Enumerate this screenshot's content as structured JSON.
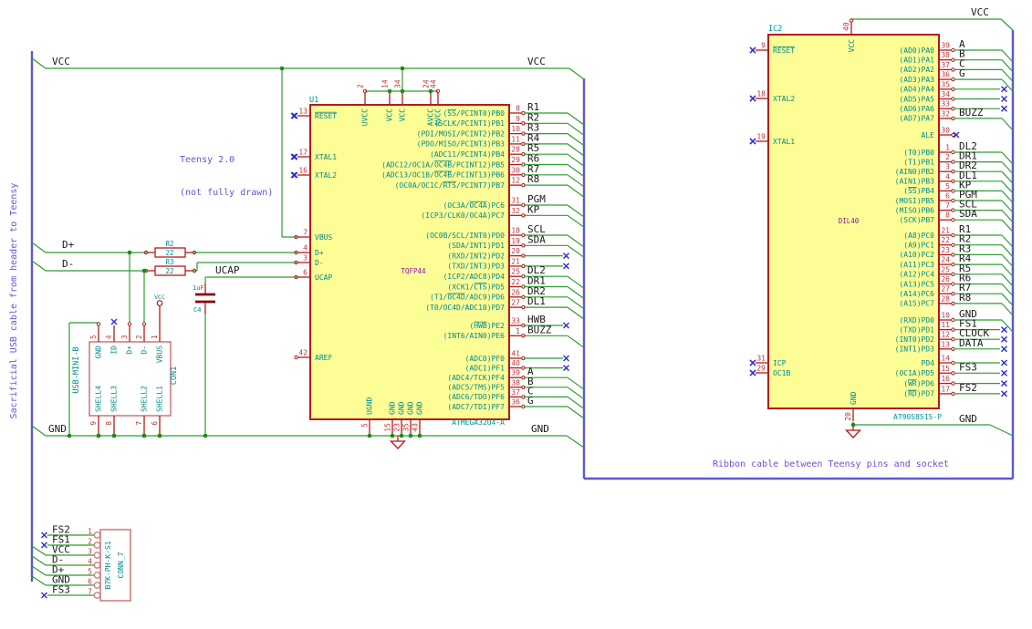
{
  "colors": {
    "wire": "#2f9e2f",
    "junction": "#1d8a1d",
    "bus": "#5b57d4",
    "device": "#b51a1a",
    "device_fill": "#fdfd96",
    "connector": "#d07f7f",
    "pin_number": "#c03535",
    "pin_name": "#008b8b",
    "reference": "#009595",
    "value": "#8a1a9e",
    "net_label": "#1a1a1a",
    "no_connect": "#2a2ad4",
    "note": "#6a52d8",
    "cap_plate": "#8b0000"
  },
  "notes": {
    "left_bus": "Sacrificial USB cable from header to Teensy",
    "teensy_line1": "Teensy 2.0",
    "teensy_line2": "(not fully drawn)",
    "ribbon": "Ribbon cable between Teensy pins and socket"
  },
  "power_labels": {
    "vcc_left": "VCC",
    "vcc_mid": "VCC",
    "vcc_right": "VCC",
    "gnd_left": "GND",
    "gnd_mid": "GND",
    "gnd_right": "GND",
    "dplus": "D+",
    "dminus": "D-",
    "ucap": "UCAP",
    "usb_vcc": "VCC"
  },
  "u1": {
    "reference": "U1",
    "value": "TQFP44",
    "part": "ATMEGA32U4-A",
    "left_pins": [
      {
        "num": "13",
        "name": "^RESET^",
        "nc": true
      },
      {
        "num": "17",
        "name": "XTAL1",
        "nc": true
      },
      {
        "num": "16",
        "name": "XTAL2",
        "nc": true
      },
      {
        "num": "7",
        "name": "VBUS"
      },
      {
        "num": "4",
        "name": "D+"
      },
      {
        "num": "3",
        "name": "D-"
      },
      {
        "num": "6",
        "name": "UCAP"
      },
      {
        "num": "42",
        "name": "AREF"
      }
    ],
    "top_pins": [
      {
        "num": "2",
        "name": "UVCC"
      },
      {
        "num": "14",
        "name": "VCC"
      },
      {
        "num": "34",
        "name": "VCC"
      },
      {
        "num": "24",
        "name": "AVCC"
      },
      {
        "num": "44",
        "name": "AVCC"
      }
    ],
    "bottom_pins": [
      {
        "num": "5",
        "name": "UGND"
      },
      {
        "num": "15",
        "name": "GND"
      },
      {
        "num": "23",
        "name": "GND"
      },
      {
        "num": "35",
        "name": "GND"
      },
      {
        "num": "43",
        "name": "GND"
      }
    ],
    "right_groups": [
      [
        {
          "num": "8",
          "name": "(^SS^/PCINT0)PB0",
          "net": "R1"
        },
        {
          "num": "9",
          "name": "(SCLK/PCINT1)PB1",
          "net": "R2"
        },
        {
          "num": "10",
          "name": "(PDI/MOSI/PCINT2)PB2",
          "net": "R3"
        },
        {
          "num": "11",
          "name": "(PDO/MISO/PCINT3)PB3",
          "net": "R4"
        },
        {
          "num": "28",
          "name": "(ADC11/PCINT4)PB4",
          "net": "R5"
        },
        {
          "num": "29",
          "name": "(ADC12/OC1A/^OC4B^/PCINT12)PB5",
          "net": "R6"
        },
        {
          "num": "30",
          "name": "(ADC13/OC1B/^OC4B^/PCINT13)PB6",
          "net": "R7"
        },
        {
          "num": "12",
          "name": "(OC0A/OC1C/^RTS^/PCINT7)PB7",
          "net": "R8"
        }
      ],
      [
        {
          "num": "31",
          "name": "(OC3A/^OC4A^)PC6",
          "net": "PGM"
        },
        {
          "num": "32",
          "name": "(ICP3/CLK0/OC4A)PC7",
          "net": "KP"
        }
      ],
      [
        {
          "num": "18",
          "name": "(OC0B/SCL/INT0)PD0",
          "net": "SCL"
        },
        {
          "num": "19",
          "name": "(SDA/INT1)PD1",
          "net": "SDA"
        },
        {
          "num": "20",
          "name": "(RXD/INT2)PD2",
          "nc": true
        },
        {
          "num": "21",
          "name": "(TXD/INT3)PD3",
          "nc": true
        },
        {
          "num": "25",
          "name": "(ICP2/ADC8)PD4",
          "net": "DL2"
        },
        {
          "num": "22",
          "name": "(XCK1/^CTS^)PD5",
          "net": "DR1"
        },
        {
          "num": "26",
          "name": "(T1/^OC4D^/ADC9)PD6",
          "net": "DR2"
        },
        {
          "num": "27",
          "name": "(T0/OC4D/ADC10)PD7",
          "net": "DL1"
        }
      ],
      [
        {
          "num": "33",
          "name": "(^HWB^)PE2",
          "net": "HWB",
          "nc": true
        },
        {
          "num": "1",
          "name": "(INT6/AIN0)PE6",
          "net": "BUZZ"
        }
      ],
      [
        {
          "num": "41",
          "name": "(ADC0)PF0",
          "nc": true
        },
        {
          "num": "40",
          "name": "(ADC1)PF1",
          "nc": true
        },
        {
          "num": "39",
          "name": "(ADC4/TCK)PF4",
          "net": "A"
        },
        {
          "num": "38",
          "name": "(ADC5/TMS)PF5",
          "net": "B"
        },
        {
          "num": "37",
          "name": "(ADC6/TDO)PF6",
          "net": "C"
        },
        {
          "num": "36",
          "name": "(ADC7/TDI)PF7",
          "net": "G"
        }
      ]
    ]
  },
  "ic2": {
    "reference": "IC2",
    "value": "DIL40",
    "part": "AT90S8515-P",
    "left_pins": [
      {
        "num": "9",
        "name": "^RESET^",
        "nc": true
      },
      {
        "num": "18",
        "name": "XTAL2",
        "nc": true
      },
      {
        "num": "19",
        "name": "XTAL1",
        "nc": true
      },
      {
        "num": "31",
        "name": "ICP",
        "nc": true
      },
      {
        "num": "29",
        "name": "OC1B",
        "nc": true
      }
    ],
    "top_pins": [
      {
        "num": "40",
        "name": "VCC"
      }
    ],
    "bottom_pins": [
      {
        "num": "20",
        "name": "GND"
      }
    ],
    "right_groups": [
      [
        {
          "num": "39",
          "name": "(AD0)PA0",
          "net": "A"
        },
        {
          "num": "38",
          "name": "(AD1)PA1",
          "net": "B"
        },
        {
          "num": "37",
          "name": "(AD2)PA2",
          "net": "C"
        },
        {
          "num": "36",
          "name": "(AD3)PA3",
          "net": "G"
        },
        {
          "num": "35",
          "name": "(AD4)PA4",
          "nc": true
        },
        {
          "num": "34",
          "name": "(AD5)PA5",
          "nc": true
        },
        {
          "num": "33",
          "name": "(AD6)PA6",
          "nc": true
        },
        {
          "num": "32",
          "name": "(AD7)PA7",
          "net": "BUZZ"
        }
      ],
      [
        {
          "num": "30",
          "name": "ALE",
          "nc": true,
          "short": true
        }
      ],
      [
        {
          "num": "1",
          "name": "(T0)PB0",
          "net": "DL2"
        },
        {
          "num": "2",
          "name": "(T1)PB1",
          "net": "DR1"
        },
        {
          "num": "3",
          "name": "(AIN0)PB2",
          "net": "DR2"
        },
        {
          "num": "4",
          "name": "(AIN1)PB3",
          "net": "DL1"
        },
        {
          "num": "5",
          "name": "(^SS^)PB4",
          "net": "KP"
        },
        {
          "num": "6",
          "name": "(MOSI)PB5",
          "net": "PGM"
        },
        {
          "num": "7",
          "name": "(MISO)PB6",
          "net": "SCL"
        },
        {
          "num": "8",
          "name": "(SCK)PB7",
          "net": "SDA"
        }
      ],
      [
        {
          "num": "21",
          "name": "(A8)PC0",
          "net": "R1"
        },
        {
          "num": "22",
          "name": "(A9)PC1",
          "net": "R2"
        },
        {
          "num": "23",
          "name": "(A10)PC2",
          "net": "R3"
        },
        {
          "num": "24",
          "name": "(A11)PC3",
          "net": "R4"
        },
        {
          "num": "25",
          "name": "(A12)PC4",
          "net": "R5"
        },
        {
          "num": "26",
          "name": "(A13)PC5",
          "net": "R6"
        },
        {
          "num": "27",
          "name": "(A14)PC6",
          "net": "R7"
        },
        {
          "num": "28",
          "name": "(A15)PC7",
          "net": "R8"
        }
      ],
      [
        {
          "num": "10",
          "name": "(RXD)PD0",
          "net": "GND"
        },
        {
          "num": "11",
          "name": "(TXD)PD1",
          "net": "FS1",
          "nc": true
        },
        {
          "num": "12",
          "name": "(INT0)PD2",
          "net": "CLOCK",
          "nc": true
        },
        {
          "num": "13",
          "name": "(INT1)PD3",
          "net": "DATA",
          "nc": true
        }
      ],
      [
        {
          "num": "14",
          "name": "PD4",
          "nc": true
        },
        {
          "num": "15",
          "name": "(OC1A)PD5",
          "net": "FS3",
          "nc": true
        },
        {
          "num": "16",
          "name": "(^WR^)PD6",
          "nc": true
        },
        {
          "num": "17",
          "name": "(^RD^)PD7",
          "net": "FS2",
          "nc": true
        }
      ]
    ]
  },
  "resistors": [
    {
      "reference": "R2",
      "value": "22"
    },
    {
      "reference": "R3",
      "value": "22"
    }
  ],
  "capacitor": {
    "reference": "C4",
    "value": "1uF"
  },
  "usb": {
    "reference": "CON1",
    "value": "USB-MINI-B",
    "top_pins": [
      {
        "num": "5",
        "name": "GND"
      },
      {
        "num": "4",
        "name": "ID",
        "nc": true
      },
      {
        "num": "3",
        "name": "D+"
      },
      {
        "num": "2",
        "name": "D-"
      },
      {
        "num": "1",
        "name": "VBUS"
      }
    ],
    "bottom_pins": [
      {
        "num": "9",
        "name": "SHELL4"
      },
      {
        "num": "8",
        "name": "SHELL3"
      },
      {
        "num": "7",
        "name": "SHELL2"
      },
      {
        "num": "6",
        "name": "SHELL1"
      }
    ]
  },
  "conn7": {
    "reference": "CONN_7",
    "value": "B7K-PH-K-S1",
    "pins": [
      {
        "num": "1",
        "net": "FS2",
        "nc": true
      },
      {
        "num": "2",
        "net": "FS1",
        "nc": true
      },
      {
        "num": "3",
        "net": "VCC"
      },
      {
        "num": "4",
        "net": "D-"
      },
      {
        "num": "5",
        "net": "D+"
      },
      {
        "num": "6",
        "net": "GND"
      },
      {
        "num": "7",
        "net": "FS3",
        "nc": true
      }
    ]
  }
}
